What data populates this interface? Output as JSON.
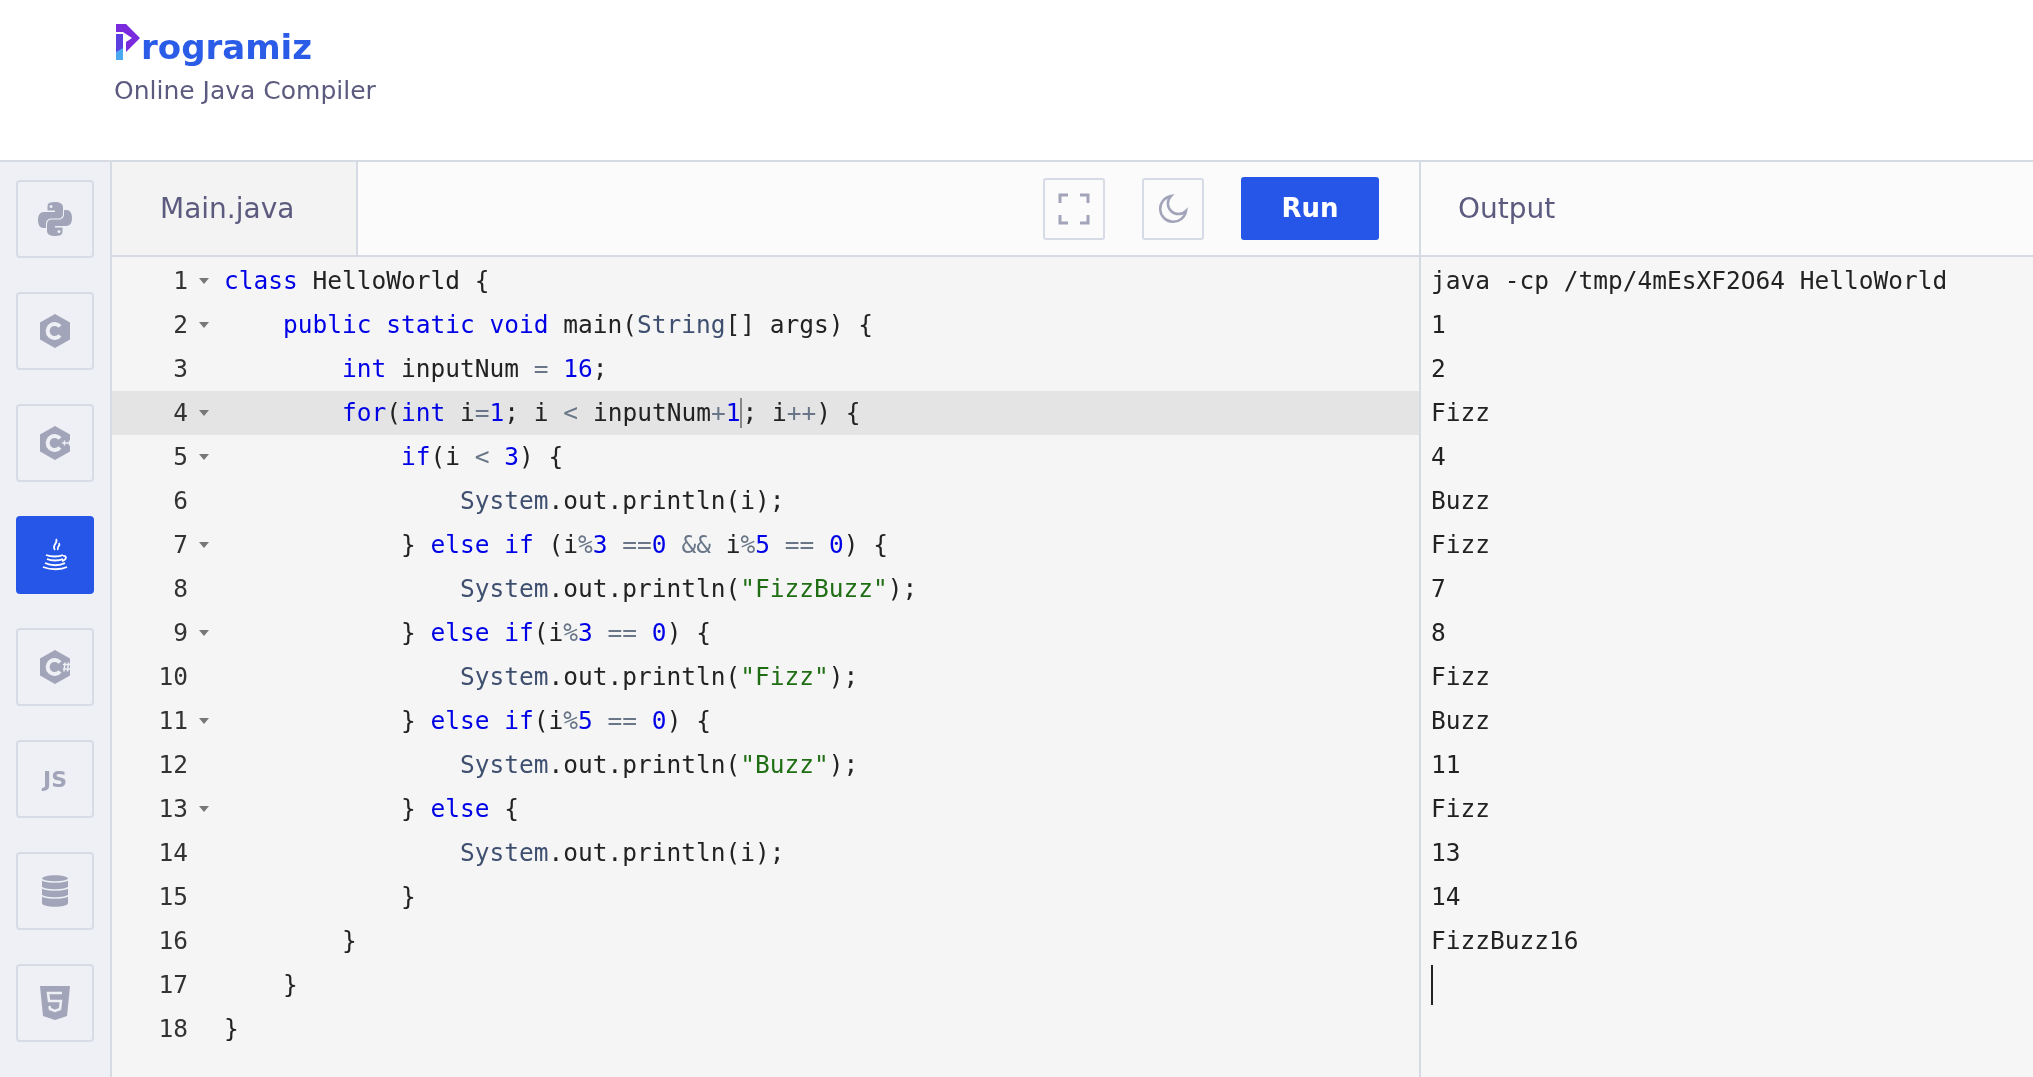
{
  "header": {
    "logo_text": "rogramiz",
    "subtitle": "Online Java Compiler"
  },
  "sidebar": {
    "items": [
      {
        "kind": "python",
        "selected": false
      },
      {
        "kind": "c",
        "selected": false
      },
      {
        "kind": "cpp",
        "selected": false
      },
      {
        "kind": "java",
        "selected": true
      },
      {
        "kind": "csharp",
        "selected": false
      },
      {
        "kind": "js",
        "label": "JS",
        "selected": false
      },
      {
        "kind": "database",
        "selected": false
      },
      {
        "kind": "html",
        "selected": false
      }
    ]
  },
  "editor": {
    "tab": "Main.java",
    "run_button": "Run",
    "lines": [
      {
        "number": "1",
        "foldable": true,
        "active": false,
        "tokens": [
          {
            "kind": "kw",
            "text": "class"
          },
          {
            "kind": "plain",
            "text": " HelloWorld {"
          }
        ]
      },
      {
        "number": "2",
        "foldable": true,
        "active": false,
        "tokens": [
          {
            "kind": "kw",
            "text": "    public"
          },
          {
            "kind": "kw",
            "text": " static"
          },
          {
            "kind": "kw",
            "text": " void"
          },
          {
            "kind": "plain",
            "text": " main("
          },
          {
            "kind": "type",
            "text": "String"
          },
          {
            "kind": "plain",
            "text": "[] args) {"
          }
        ]
      },
      {
        "number": "3",
        "foldable": false,
        "active": false,
        "tokens": [
          {
            "kind": "kw",
            "text": "        int"
          },
          {
            "kind": "plain",
            "text": " inputNum "
          },
          {
            "kind": "op",
            "text": "="
          },
          {
            "kind": "num",
            "text": " 16"
          },
          {
            "kind": "plain",
            "text": ";"
          }
        ]
      },
      {
        "number": "4",
        "foldable": true,
        "active": true,
        "tokens": [
          {
            "kind": "kw",
            "text": "        for"
          },
          {
            "kind": "plain",
            "text": "("
          },
          {
            "kind": "kw",
            "text": "int"
          },
          {
            "kind": "plain",
            "text": " i"
          },
          {
            "kind": "op",
            "text": "="
          },
          {
            "kind": "num",
            "text": "1"
          },
          {
            "kind": "plain",
            "text": "; i "
          },
          {
            "kind": "op",
            "text": "<"
          },
          {
            "kind": "plain",
            "text": " inputNum"
          },
          {
            "kind": "op",
            "text": "+"
          },
          {
            "kind": "num",
            "text": "1",
            "caret_after": true
          },
          {
            "kind": "plain",
            "text": "; i"
          },
          {
            "kind": "op",
            "text": "++"
          },
          {
            "kind": "plain",
            "text": ") {"
          }
        ]
      },
      {
        "number": "5",
        "foldable": true,
        "active": false,
        "tokens": [
          {
            "kind": "kw",
            "text": "            if"
          },
          {
            "kind": "plain",
            "text": "(i "
          },
          {
            "kind": "op",
            "text": "<"
          },
          {
            "kind": "num",
            "text": " 3"
          },
          {
            "kind": "plain",
            "text": ") {"
          }
        ]
      },
      {
        "number": "6",
        "foldable": false,
        "active": false,
        "tokens": [
          {
            "kind": "type",
            "text": "                System"
          },
          {
            "kind": "plain",
            "text": ".out.println(i);"
          }
        ]
      },
      {
        "number": "7",
        "foldable": true,
        "active": false,
        "tokens": [
          {
            "kind": "plain",
            "text": "            } "
          },
          {
            "kind": "kw",
            "text": "else"
          },
          {
            "kind": "kw",
            "text": " if"
          },
          {
            "kind": "plain",
            "text": " (i"
          },
          {
            "kind": "op",
            "text": "%"
          },
          {
            "kind": "num",
            "text": "3"
          },
          {
            "kind": "op",
            "text": " =="
          },
          {
            "kind": "num",
            "text": "0"
          },
          {
            "kind": "op",
            "text": " &&"
          },
          {
            "kind": "plain",
            "text": " i"
          },
          {
            "kind": "op",
            "text": "%"
          },
          {
            "kind": "num",
            "text": "5"
          },
          {
            "kind": "op",
            "text": " =="
          },
          {
            "kind": "num",
            "text": " 0"
          },
          {
            "kind": "plain",
            "text": ") {"
          }
        ]
      },
      {
        "number": "8",
        "foldable": false,
        "active": false,
        "tokens": [
          {
            "kind": "type",
            "text": "                System"
          },
          {
            "kind": "plain",
            "text": ".out.println("
          },
          {
            "kind": "str",
            "text": "\"FizzBuzz\""
          },
          {
            "kind": "plain",
            "text": ");"
          }
        ]
      },
      {
        "number": "9",
        "foldable": true,
        "active": false,
        "tokens": [
          {
            "kind": "plain",
            "text": "            } "
          },
          {
            "kind": "kw",
            "text": "else"
          },
          {
            "kind": "kw",
            "text": " if"
          },
          {
            "kind": "plain",
            "text": "(i"
          },
          {
            "kind": "op",
            "text": "%"
          },
          {
            "kind": "num",
            "text": "3"
          },
          {
            "kind": "op",
            "text": " =="
          },
          {
            "kind": "num",
            "text": " 0"
          },
          {
            "kind": "plain",
            "text": ") {"
          }
        ]
      },
      {
        "number": "10",
        "foldable": false,
        "active": false,
        "tokens": [
          {
            "kind": "type",
            "text": "                System"
          },
          {
            "kind": "plain",
            "text": ".out.println("
          },
          {
            "kind": "str",
            "text": "\"Fizz\""
          },
          {
            "kind": "plain",
            "text": ");"
          }
        ]
      },
      {
        "number": "11",
        "foldable": true,
        "active": false,
        "tokens": [
          {
            "kind": "plain",
            "text": "            } "
          },
          {
            "kind": "kw",
            "text": "else"
          },
          {
            "kind": "kw",
            "text": " if"
          },
          {
            "kind": "plain",
            "text": "(i"
          },
          {
            "kind": "op",
            "text": "%"
          },
          {
            "kind": "num",
            "text": "5"
          },
          {
            "kind": "op",
            "text": " =="
          },
          {
            "kind": "num",
            "text": " 0"
          },
          {
            "kind": "plain",
            "text": ") {"
          }
        ]
      },
      {
        "number": "12",
        "foldable": false,
        "active": false,
        "tokens": [
          {
            "kind": "type",
            "text": "                System"
          },
          {
            "kind": "plain",
            "text": ".out.println("
          },
          {
            "kind": "str",
            "text": "\"Buzz\""
          },
          {
            "kind": "plain",
            "text": ");"
          }
        ]
      },
      {
        "number": "13",
        "foldable": true,
        "active": false,
        "tokens": [
          {
            "kind": "plain",
            "text": "            } "
          },
          {
            "kind": "kw",
            "text": "else"
          },
          {
            "kind": "plain",
            "text": " {"
          }
        ]
      },
      {
        "number": "14",
        "foldable": false,
        "active": false,
        "tokens": [
          {
            "kind": "type",
            "text": "                System"
          },
          {
            "kind": "plain",
            "text": ".out.println(i);"
          }
        ]
      },
      {
        "number": "15",
        "foldable": false,
        "active": false,
        "tokens": [
          {
            "kind": "plain",
            "text": "            }"
          }
        ]
      },
      {
        "number": "16",
        "foldable": false,
        "active": false,
        "tokens": [
          {
            "kind": "plain",
            "text": "        }"
          }
        ]
      },
      {
        "number": "17",
        "foldable": false,
        "active": false,
        "tokens": [
          {
            "kind": "plain",
            "text": "    }"
          }
        ]
      },
      {
        "number": "18",
        "foldable": false,
        "active": false,
        "tokens": [
          {
            "kind": "plain",
            "text": "}"
          }
        ]
      }
    ]
  },
  "output": {
    "title": "Output",
    "caret": true,
    "lines": [
      "java -cp /tmp/4mEsXF2O64 HelloWorld",
      "1",
      "2",
      "Fizz",
      "4",
      "Buzz",
      "Fizz",
      "7",
      "8",
      "Fizz",
      "Buzz",
      "11",
      "Fizz",
      "13",
      "14",
      "FizzBuzz16"
    ]
  }
}
